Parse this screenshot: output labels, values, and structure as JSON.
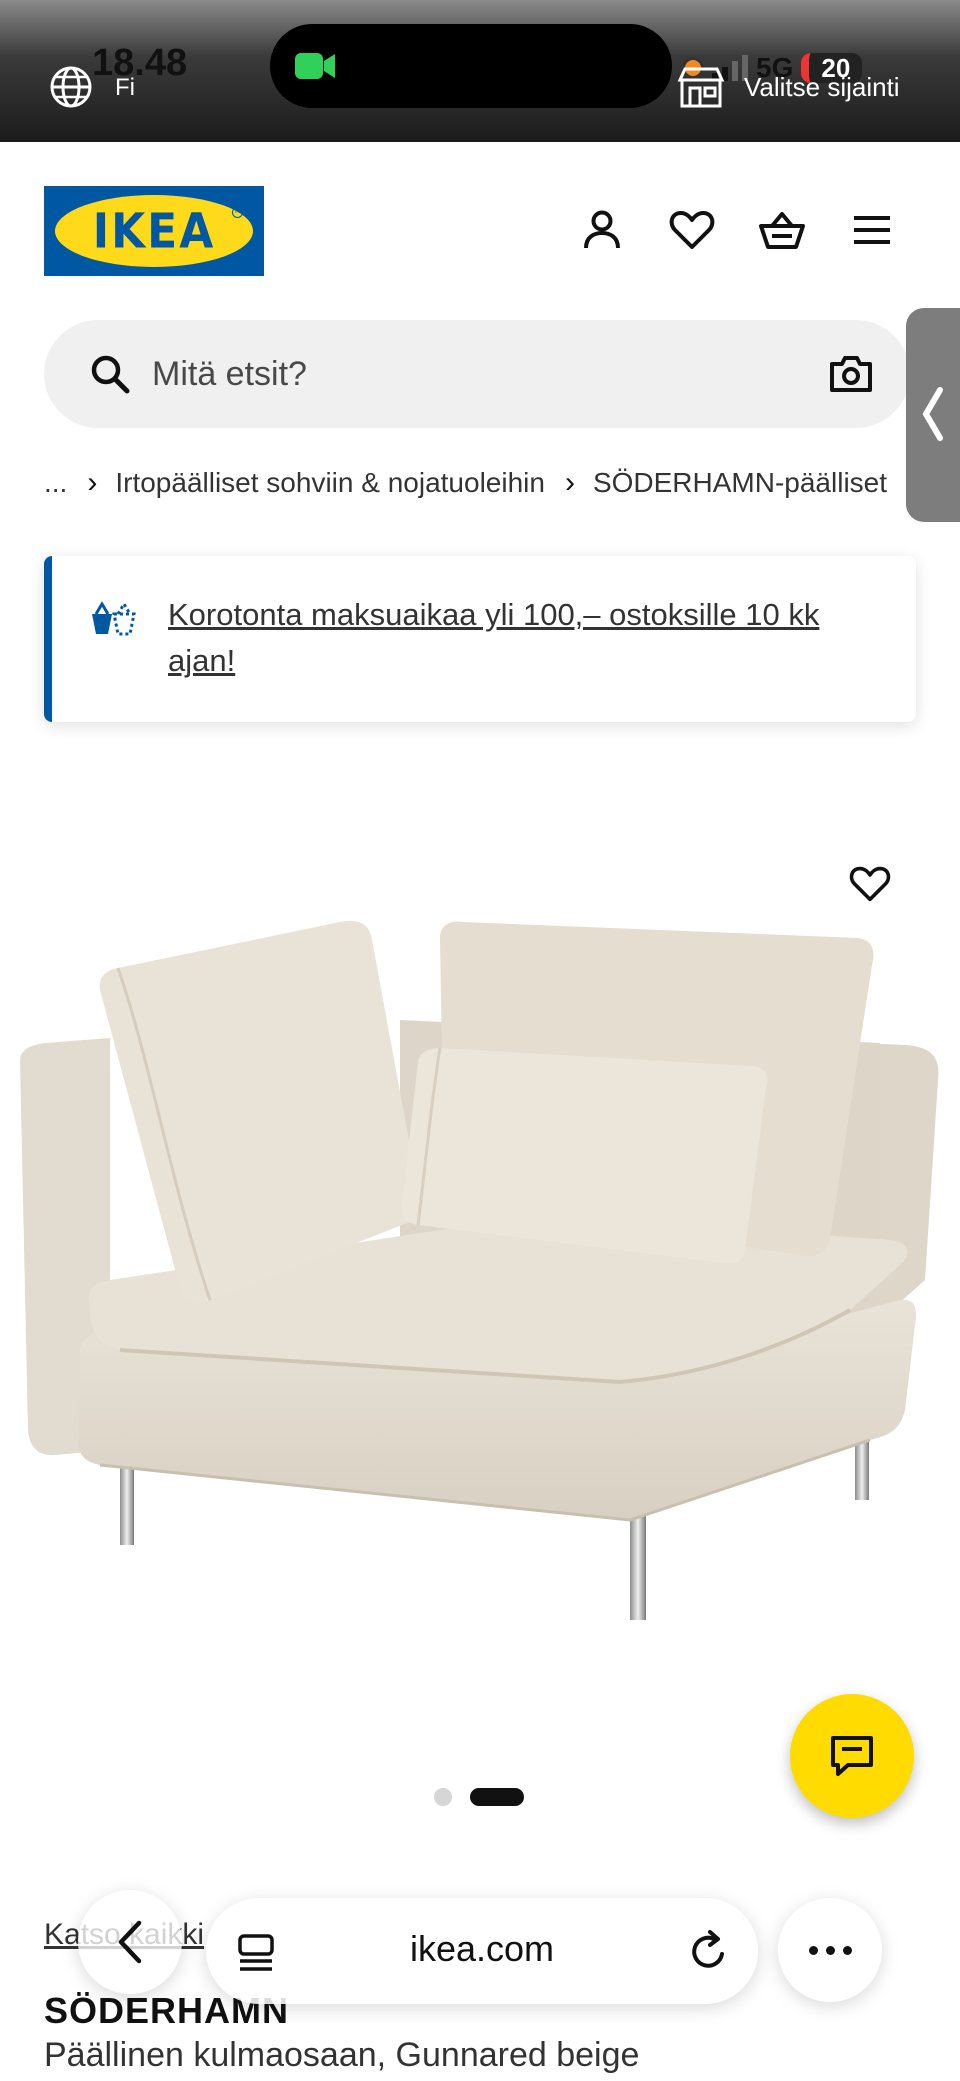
{
  "status": {
    "time": "18.48",
    "sub_label": "Fi",
    "network": "5G",
    "battery": "20",
    "store_label": "Valitse sijainti"
  },
  "header": {
    "logo_text": "IKEA",
    "icons": [
      "account-icon",
      "heart-icon",
      "basket-icon",
      "menu-icon"
    ]
  },
  "search": {
    "placeholder": "Mitä etsit?"
  },
  "breadcrumb": {
    "items": [
      "...",
      "Irtopäälliset sohviin & nojatuoleihin",
      "SÖDERHAMN-päälliset"
    ]
  },
  "promo": {
    "text": "Korotonta maksuaikaa yli 100,– ostoksille 10 kk ajan!"
  },
  "product": {
    "series_link": "Katso kaikki",
    "name": "SÖDERHAMN",
    "description": "Päällinen kulmaosaan, Gunnared beige",
    "image_count": 2,
    "active_image": 2
  },
  "browser": {
    "url": "ikea.com"
  },
  "colors": {
    "ikea_blue": "#0058a3",
    "ikea_yellow": "#ffda1a",
    "chat_yellow": "#ffdb00"
  }
}
